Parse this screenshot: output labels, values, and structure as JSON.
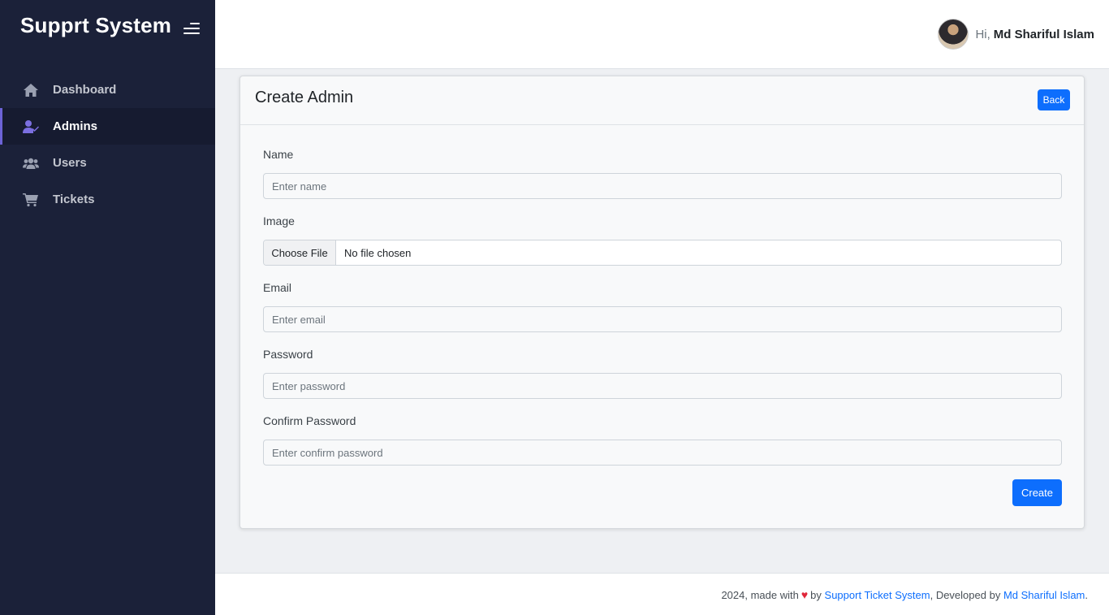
{
  "sidebar": {
    "brand": "Supprt System",
    "items": [
      {
        "label": "Dashboard",
        "icon": "home-icon",
        "active": false
      },
      {
        "label": "Admins",
        "icon": "user-check-icon",
        "active": true
      },
      {
        "label": "Users",
        "icon": "users-icon",
        "active": false
      },
      {
        "label": "Tickets",
        "icon": "cart-icon",
        "active": false
      }
    ]
  },
  "header": {
    "greeting": "Hi,",
    "user_name": "Md Shariful Islam"
  },
  "card": {
    "title": "Create Admin",
    "back_label": "Back"
  },
  "form": {
    "name": {
      "label": "Name",
      "placeholder": "Enter name"
    },
    "image": {
      "label": "Image",
      "button": "Choose File",
      "status": "No file chosen"
    },
    "email": {
      "label": "Email",
      "placeholder": "Enter email"
    },
    "password": {
      "label": "Password",
      "placeholder": "Enter password"
    },
    "confirm": {
      "label": "Confirm Password",
      "placeholder": "Enter confirm password"
    },
    "submit_label": "Create"
  },
  "footer": {
    "prefix": "2024, made with",
    "by": "by",
    "link1": "Support Ticket System",
    "developed": ", Developed by",
    "link2": "Md Shariful Islam",
    "suffix": "."
  },
  "colors": {
    "sidebar_bg": "#1b2139",
    "accent": "#6c63d6",
    "primary": "#0d6efd",
    "heart": "#e0263a"
  }
}
